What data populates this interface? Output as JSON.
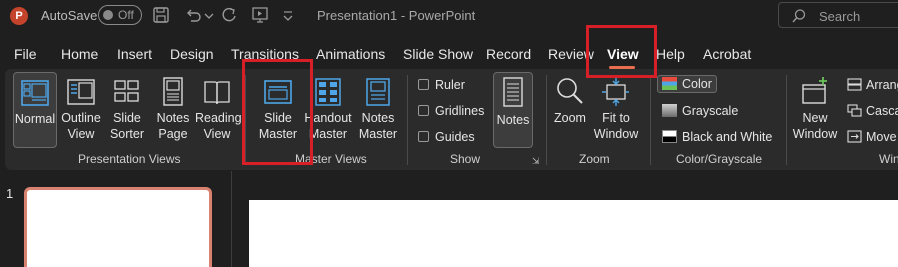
{
  "titlebar": {
    "app_icon": "powerpoint-logo",
    "app_icon_letter": "P",
    "autosave_label": "AutoSave",
    "autosave_state": "Off",
    "document_title": "Presentation1  -  PowerPoint",
    "search_placeholder": "Search"
  },
  "tabs": [
    {
      "label": "File"
    },
    {
      "label": "Home"
    },
    {
      "label": "Insert"
    },
    {
      "label": "Design"
    },
    {
      "label": "Transitions"
    },
    {
      "label": "Animations"
    },
    {
      "label": "Slide Show"
    },
    {
      "label": "Record"
    },
    {
      "label": "Review"
    },
    {
      "label": "View",
      "active": true
    },
    {
      "label": "Help"
    },
    {
      "label": "Acrobat"
    }
  ],
  "ribbon": {
    "presentation_views": {
      "label": "Presentation Views",
      "buttons": [
        {
          "line1": "Normal",
          "line2": "",
          "icon": "normal-view-icon",
          "selected": true
        },
        {
          "line1": "Outline",
          "line2": "View",
          "icon": "outline-view-icon"
        },
        {
          "line1": "Slide",
          "line2": "Sorter",
          "icon": "slide-sorter-icon"
        },
        {
          "line1": "Notes",
          "line2": "Page",
          "icon": "notes-page-icon"
        },
        {
          "line1": "Reading",
          "line2": "View",
          "icon": "reading-view-icon"
        }
      ]
    },
    "master_views": {
      "label": "Master Views",
      "buttons": [
        {
          "line1": "Slide",
          "line2": "Master",
          "icon": "slide-master-icon"
        },
        {
          "line1": "Handout",
          "line2": "Master",
          "icon": "handout-master-icon"
        },
        {
          "line1": "Notes",
          "line2": "Master",
          "icon": "notes-master-icon"
        }
      ]
    },
    "show": {
      "label": "Show",
      "checks": [
        "Ruler",
        "Gridlines",
        "Guides"
      ],
      "notes_button": "Notes"
    },
    "zoom": {
      "label": "Zoom",
      "zoom_button": "Zoom",
      "fit_line1": "Fit to",
      "fit_line2": "Window"
    },
    "color_grayscale": {
      "label": "Color/Grayscale",
      "options": [
        "Color",
        "Grayscale",
        "Black and White"
      ]
    },
    "window": {
      "label": "Win",
      "new_window_line1": "New",
      "new_window_line2": "Window",
      "arrange": "Arrang",
      "cascade": "Casca",
      "move": "Move"
    }
  },
  "slides_panel": {
    "slide_number": "1"
  },
  "colors": {
    "accent": "#e86e4f",
    "highlight": "#d61f26",
    "selected_thumb_border": "#d98270",
    "icon_blue": "#4ea6e8"
  }
}
